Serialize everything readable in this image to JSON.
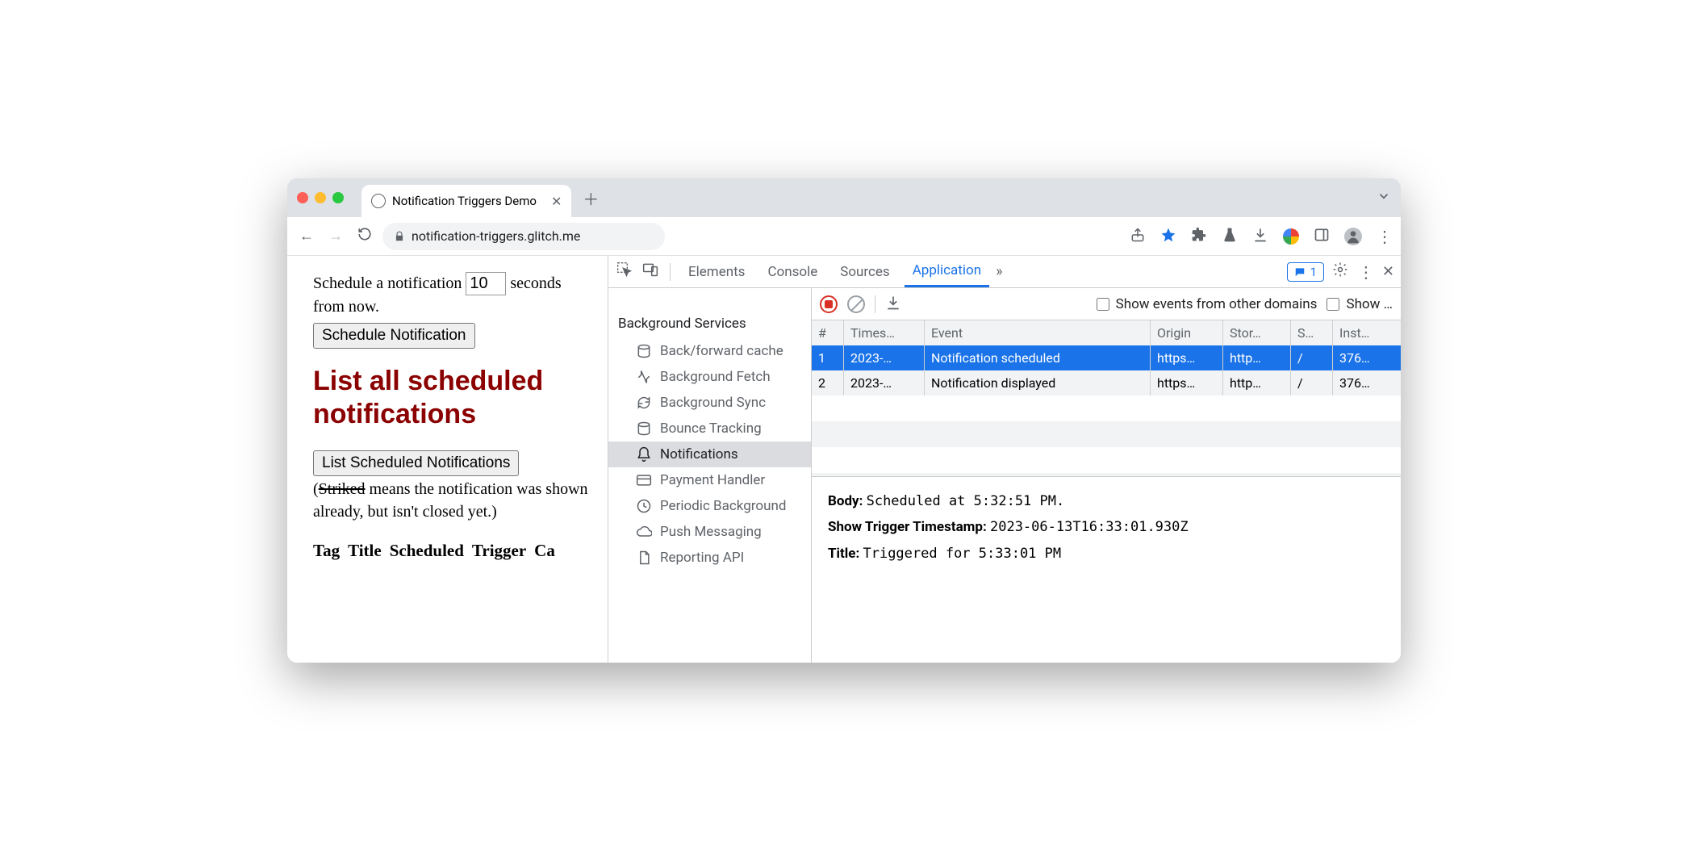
{
  "tab": {
    "title": "Notification Triggers Demo"
  },
  "address": {
    "url": "notification-triggers.glitch.me"
  },
  "page": {
    "schedule_text_a": "Schedule a notification ",
    "schedule_text_b": " seconds from now.",
    "seconds_value": "10",
    "schedule_button": "Schedule Notification",
    "heading": "List all scheduled notifications",
    "list_button": "List Scheduled Notifications",
    "note_a": "(",
    "note_strike": "Striked",
    "note_b": " means the notification was shown already, but isn't closed yet.)",
    "th": [
      "Tag",
      "Title",
      "Scheduled",
      "Trigger",
      "Ca"
    ]
  },
  "devtools": {
    "tabs": [
      "Elements",
      "Console",
      "Sources",
      "Application"
    ],
    "active_tab": "Application",
    "msg_count": "1"
  },
  "sidebar": {
    "header": "Background Services",
    "items": [
      "Back/forward cache",
      "Background Fetch",
      "Background Sync",
      "Bounce Tracking",
      "Notifications",
      "Payment Handler",
      "Periodic Background",
      "Push Messaging",
      "Reporting API"
    ],
    "active_index": 4
  },
  "toolbar": {
    "chk1": "Show events from other domains",
    "chk2": "Show …"
  },
  "grid": {
    "headers": [
      "#",
      "Times…",
      "Event",
      "Origin",
      "Stor…",
      "S…",
      "Inst…"
    ],
    "rows": [
      {
        "n": "1",
        "ts": "2023-…",
        "ev": "Notification scheduled",
        "or": "https…",
        "st": "http…",
        "s": "/",
        "in": "376…"
      },
      {
        "n": "2",
        "ts": "2023-…",
        "ev": "Notification displayed",
        "or": "https…",
        "st": "http…",
        "s": "/",
        "in": "376…"
      }
    ],
    "selected": 0
  },
  "details": {
    "body_k": "Body:",
    "body_v": "Scheduled at 5:32:51 PM.",
    "ts_k": "Show Trigger Timestamp:",
    "ts_v": "2023-06-13T16:33:01.930Z",
    "title_k": "Title:",
    "title_v": "Triggered for 5:33:01 PM"
  }
}
